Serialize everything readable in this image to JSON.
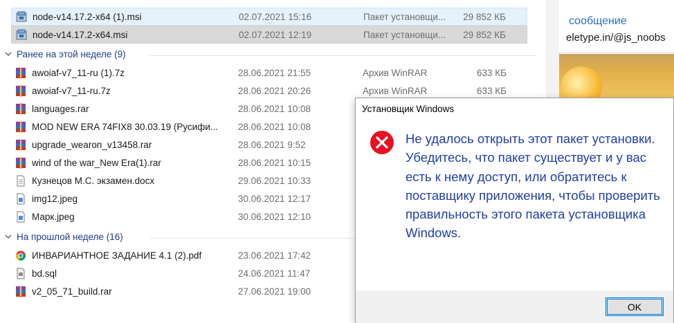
{
  "explorer": {
    "top_rows": [
      {
        "name": "node-v14.17.2-x64 (1).msi",
        "date": "02.07.2021 15:16",
        "type": "Пакет установщи...",
        "size": "29 852 КБ",
        "icon": "msi-installer-icon",
        "state": "hover"
      },
      {
        "name": "node-v14.17.2-x64.msi",
        "date": "02.07.2021 12:19",
        "type": "Пакет установщи...",
        "size": "29 852 КБ",
        "icon": "msi-installer-icon",
        "state": "selected"
      }
    ],
    "groups": [
      {
        "label": "Ранее на этой неделе (9)",
        "files": [
          {
            "name": "awoiaf-v7_11-ru (1).7z",
            "date": "28.06.2021 21:55",
            "type": "Архив WinRAR",
            "size": "633 КБ",
            "icon": "winrar-archive-icon"
          },
          {
            "name": "awoiaf-v7_11-ru.7z",
            "date": "28.06.2021 20:26",
            "type": "Архив WinRAR",
            "size": "633 КБ",
            "icon": "winrar-archive-icon"
          },
          {
            "name": "languages.rar",
            "date": "28.06.2021 10:08",
            "type": "",
            "size": "",
            "icon": "winrar-archive-icon"
          },
          {
            "name": "MOD NEW ERA 74FIX8 30.03.19 (Русифи...",
            "date": "28.06.2021 10:08",
            "type": "",
            "size": "",
            "icon": "winrar-archive-icon"
          },
          {
            "name": "upgrade_wearon_v13458.rar",
            "date": "28.06.2021 9:52",
            "type": "",
            "size": "",
            "icon": "winrar-archive-icon"
          },
          {
            "name": "wind of the war_New Era(1).rar",
            "date": "28.06.2021 10:15",
            "type": "",
            "size": "",
            "icon": "winrar-archive-icon"
          },
          {
            "name": "Кузнецов М.С. экзамен.docx",
            "date": "29.06.2021 10:33",
            "type": "",
            "size": "",
            "icon": "document-icon"
          },
          {
            "name": "img12.jpeg",
            "date": "30.06.2021 12:17",
            "type": "",
            "size": "",
            "icon": "image-file-icon"
          },
          {
            "name": "Марк.jpeg",
            "date": "30.06.2021 12:10",
            "type": "",
            "size": "",
            "icon": "image-file-icon"
          }
        ]
      },
      {
        "label": "На прошлой неделе (16)",
        "files": [
          {
            "name": "ИНВАРИАНТНОЕ ЗАДАНИЕ 4.1 (2).pdf",
            "date": "23.06.2021 17:42",
            "type": "",
            "size": "",
            "icon": "chrome-pdf-icon"
          },
          {
            "name": "bd.sql",
            "date": "24.06.2021 11:47",
            "type": "",
            "size": "",
            "icon": "sql-file-icon"
          },
          {
            "name": "v2_05_71_build.rar",
            "date": "27.06.2021 19:00",
            "type": "",
            "size": "",
            "icon": "winrar-archive-icon"
          }
        ]
      }
    ]
  },
  "background_window": {
    "title": "сообщение",
    "url": "eletype.in/@js_noobs"
  },
  "dialog": {
    "title": "Установщик Windows",
    "message": "Не удалось открыть этот пакет установки. Убедитесь, что пакет существует и у вас есть к нему доступ, или обратитесь к поставщику приложения, чтобы проверить правильность этого пакета установщика Windows.",
    "ok_label": "OK",
    "icon": "error-icon"
  },
  "colors": {
    "group_header": "#1e3c8c",
    "dialog_text": "#1f3fa6",
    "error_red": "#e81123",
    "accent": "#0078d7"
  }
}
